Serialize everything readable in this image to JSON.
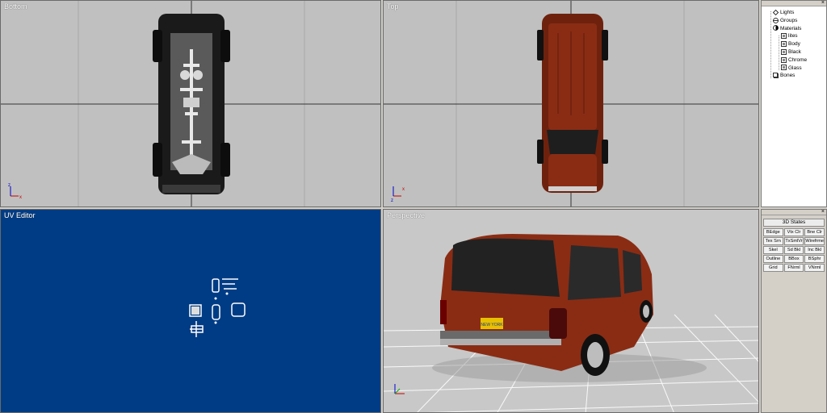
{
  "viewports": {
    "bottom": {
      "label": "Bottom"
    },
    "top": {
      "label": "Top"
    },
    "uv": {
      "label": "UV Editor"
    },
    "perspective": {
      "label": "Perspective"
    }
  },
  "axes": {
    "x": "x",
    "y": "y",
    "z": "z"
  },
  "license_plate": "NEW YORK",
  "tree": {
    "items": [
      {
        "label": "Lights",
        "icon": "light-icon",
        "level": 0
      },
      {
        "label": "Groups",
        "icon": "group-icon",
        "level": 0
      },
      {
        "label": "Materials",
        "icon": "material-icon",
        "level": 0
      },
      {
        "label": "lites",
        "icon": "material-swatch-icon",
        "level": 1
      },
      {
        "label": "Body",
        "icon": "material-swatch-icon",
        "level": 1
      },
      {
        "label": "Black",
        "icon": "material-swatch-icon",
        "level": 1
      },
      {
        "label": "Chrome",
        "icon": "material-swatch-icon",
        "level": 1
      },
      {
        "label": "Glass",
        "icon": "material-swatch-icon",
        "level": 1
      },
      {
        "label": "Bones",
        "icon": "bone-icon",
        "level": 0
      }
    ]
  },
  "states": {
    "title": "3D States",
    "buttons": [
      "BEdge",
      "Vtx Clr",
      "Bne Clr",
      "Tex Srn",
      "TxSmlVr",
      "Wirefrme",
      "Skel",
      "Sd Bkl",
      "Inc Bkl",
      "Outline",
      "BBox",
      "BSphr",
      "Grid",
      "FNrml",
      "VNrml"
    ]
  },
  "colors": {
    "uv_bg": "#003c85",
    "body": "#8a2c14",
    "viewport_bg": "#c0c0c0"
  }
}
